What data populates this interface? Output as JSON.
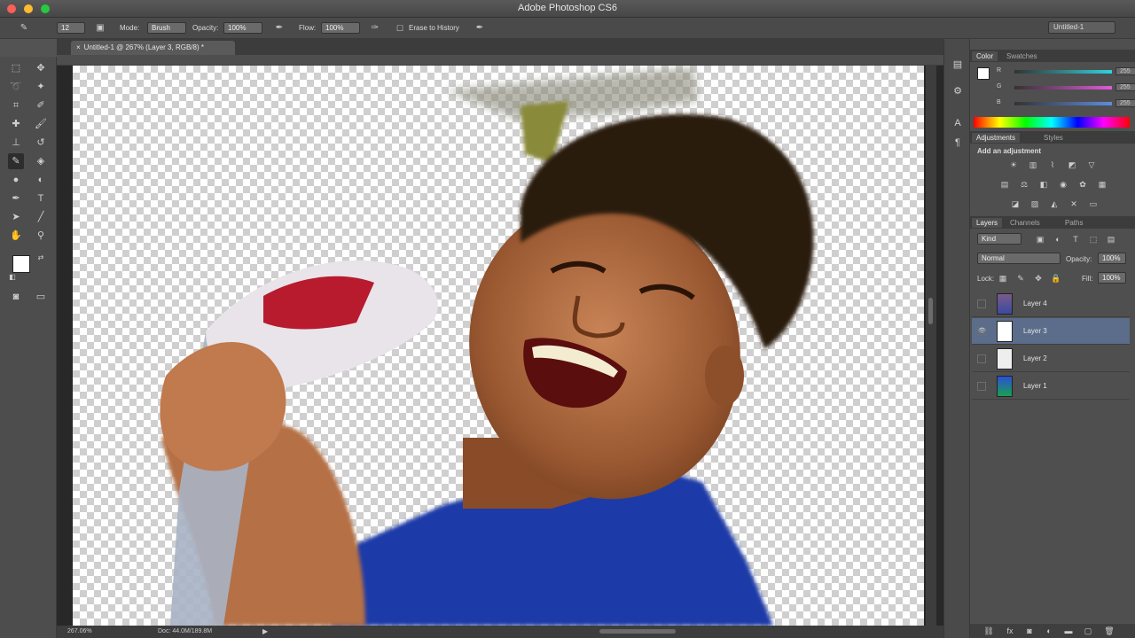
{
  "app": {
    "title": "Adobe Photoshop CS6",
    "workspace": "Untitled-1"
  },
  "options_bar": {
    "mode_label": "Mode:",
    "mode_value": "Brush",
    "opacity_label": "Opacity:",
    "opacity_value": "100%",
    "flow_label": "Flow:",
    "flow_value": "100%",
    "erase_to_history_label": "Erase to History",
    "brush_size": "12"
  },
  "document": {
    "tab_title": "Untitled-1 @ 267% (Layer 3, RGB/8) *"
  },
  "status_bar": {
    "zoom": "267.06%",
    "doc_size": "Doc: 44.0M/189.8M"
  },
  "color_panel": {
    "tabs": [
      "Color",
      "Swatches"
    ],
    "channels": [
      {
        "label": "R",
        "value": "255",
        "color": "#2fd3e0"
      },
      {
        "label": "G",
        "value": "255",
        "color": "#e05ad8"
      },
      {
        "label": "B",
        "value": "255",
        "color": "#5c8ce0"
      }
    ]
  },
  "adjustments_panel": {
    "tabs": [
      "Adjustments",
      "Styles"
    ],
    "header": "Add an adjustment"
  },
  "layers_panel": {
    "tabs": [
      "Layers",
      "Channels",
      "Paths"
    ],
    "filter_kind": "Kind",
    "blend_mode": "Normal",
    "opacity_label": "Opacity:",
    "opacity_value": "100%",
    "lock_label": "Lock:",
    "fill_label": "Fill:",
    "fill_value": "100%",
    "layers": [
      {
        "name": "Layer 4",
        "visible": false,
        "selected": false
      },
      {
        "name": "Layer 3",
        "visible": true,
        "selected": true
      },
      {
        "name": "Layer 2",
        "visible": false,
        "selected": false
      },
      {
        "name": "Layer 1",
        "visible": false,
        "selected": false
      }
    ]
  },
  "colors": {
    "foreground": "#ffffff",
    "background": "#000000",
    "selection": "#5b6d8a"
  }
}
